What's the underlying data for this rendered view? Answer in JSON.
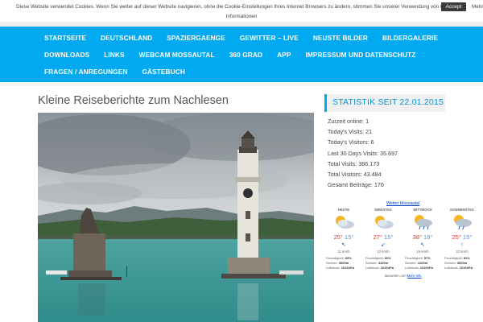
{
  "cookie_bar": {
    "text": "Diese Website verwendet Cookies. Wenn Sie weiter auf dieser Website navigieren, ohne die Cookie-Einstellungen Ihres Internet Browsers zu ändern, stimmen Sie unserer Verwendung von Cookies zu.",
    "accept_label": "Accept",
    "more_label": "Mehr",
    "info_label": "Informationen"
  },
  "nav": {
    "row1": [
      "STARTSEITE",
      "DEUTSCHLAND",
      "SPAZIERGAENGE",
      "GEWITTER – LIVE",
      "NEUSTE BILDER",
      "BILDERGALERIE"
    ],
    "row2": [
      "DOWNLOADS",
      "LINKS",
      "WEBCAM MOSSAUTAL",
      "360 GRAD",
      "APP",
      "IMPRESSUM UND DATENSCHUTZ"
    ],
    "row3": [
      "FRAGEN / ANREGUNGEN",
      "GÄSTEBUCH"
    ]
  },
  "post": {
    "title": "Kleine Reiseberichte zum Nachlesen"
  },
  "sidebar": {
    "widget_title": "STATISTIK SEIT 22.01.2015",
    "stats": [
      "Zurzeit online: 1",
      "Today's Visits: 21",
      "Today's Visitors: 6",
      "Last 30 Days Visits: 35.697",
      "Total Visits: 386.173",
      "Total Visitors: 43.484",
      "Gesamt Beiträge: 176"
    ]
  },
  "weather": {
    "link_label": "Wetter Mossautal",
    "days": [
      {
        "name": "HEUTE",
        "hi": "25°",
        "lo": "15°",
        "wind_dir": "↖",
        "speed": "11 km/h",
        "humidity": "69%",
        "snow": "3000m",
        "pressure": "1016hPa",
        "icon": "sun-cloud-icon"
      },
      {
        "name": "DIENSTAG",
        "hi": "27°",
        "lo": "15°",
        "wind_dir": "↙",
        "speed": "12 km/h",
        "humidity": "60%",
        "snow": "4100m",
        "pressure": "1016hPa",
        "icon": "sun-cloud-icon"
      },
      {
        "name": "MITTWOCH",
        "hi": "38°",
        "lo": "18°",
        "wind_dir": "↖",
        "speed": "16 km/h",
        "humidity": "57%",
        "snow": "4100m",
        "pressure": "1016hPa",
        "icon": "sun-cloud-rain-icon"
      },
      {
        "name": "DONNERSTAG",
        "hi": "25°",
        "lo": "15°",
        "wind_dir": "↑",
        "speed": "22 km/h",
        "humidity": "81%",
        "snow": "3000m",
        "pressure": "1016hPa",
        "icon": "sun-cloud-rain-icon"
      }
    ],
    "detail_labels": {
      "humidity": "Feuchtigkeit",
      "snow": "Schnee",
      "pressure": "Luftdruck"
    },
    "footer_text": "daswetter.com",
    "footer_link": "Mehr Info"
  },
  "colors": {
    "nav_bg": "#00a9f0",
    "accent": "#0096d8"
  }
}
